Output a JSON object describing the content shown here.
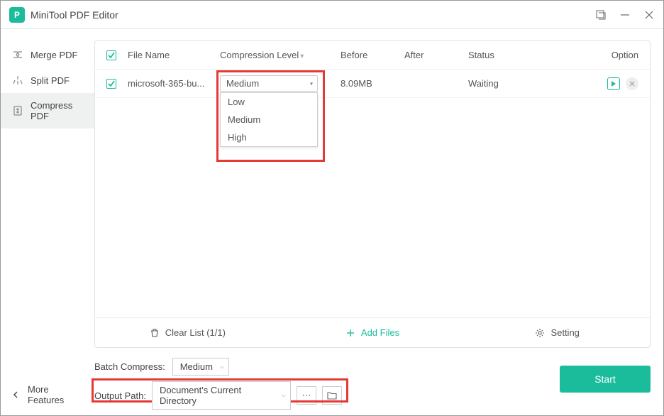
{
  "app": {
    "title": "MiniTool PDF Editor"
  },
  "sidebar": {
    "items": [
      {
        "label": "Merge PDF"
      },
      {
        "label": "Split PDF"
      },
      {
        "label": "Compress PDF"
      }
    ],
    "more": "More Features"
  },
  "table": {
    "headers": {
      "file_name": "File Name",
      "compression_level": "Compression Level",
      "before": "Before",
      "after": "After",
      "status": "Status",
      "option": "Option"
    },
    "rows": [
      {
        "file_name": "microsoft-365-bu...",
        "level_selected": "Medium",
        "level_options": [
          "Low",
          "Medium",
          "High"
        ],
        "before": "8.09MB",
        "after": "",
        "status": "Waiting"
      }
    ],
    "footer": {
      "clear": "Clear List (1/1)",
      "add": "Add Files",
      "setting": "Setting"
    }
  },
  "bottom": {
    "batch_label": "Batch Compress:",
    "batch_value": "Medium",
    "output_label": "Output Path:",
    "output_value": "Document's Current Directory",
    "start": "Start"
  }
}
